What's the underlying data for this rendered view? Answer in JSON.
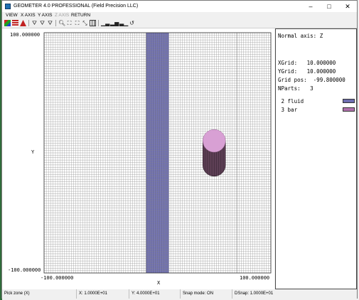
{
  "window": {
    "title": "GEOMETER 4.0 PROFESSIONAL (Field Precision LLC)",
    "minimize_glyph": "–",
    "maximize_glyph": "□",
    "close_glyph": "✕"
  },
  "menu": [
    {
      "label": "VIEW",
      "enabled": true
    },
    {
      "label": "X AXIS",
      "enabled": true
    },
    {
      "label": "Y AXIS",
      "enabled": true
    },
    {
      "label": "Z AXIS",
      "enabled": false
    },
    {
      "label": "RETURN",
      "enabled": true
    }
  ],
  "toolbar": [
    "palette-icon",
    "layers-icon",
    "fill-icon",
    "filter-icon",
    "filter-list-icon",
    "filter-down-icon",
    "zoom-icon",
    "zoom-window-icon",
    "zoom-fit-icon",
    "zoom-out-icon",
    "grid-icon",
    "bar-chart-icon",
    "histogram-icon",
    "chart-alt-icon",
    "undo-icon"
  ],
  "plot": {
    "x_min_label": "-100.000000",
    "x_max_label": "100.000000",
    "y_max_label": "100.000000",
    "y_min_label": "-100.000000",
    "x_axis_label": "X",
    "y_axis_label": "Y",
    "x_range": [
      -100,
      100
    ],
    "y_range": [
      -100,
      100
    ],
    "grid_spacing": 2,
    "coarse_lines_x": [
      -10,
      70
    ],
    "parts": [
      {
        "name": "fluid",
        "shape": "vertical-band",
        "x_from": -10,
        "x_to": 10,
        "color": "#7b7bb9"
      },
      {
        "name": "bar",
        "shape": "rod-end-on",
        "center_x": 50,
        "center_y": 10,
        "radius": 10,
        "lower_y": -10,
        "top_color": "#d8a0d4",
        "body_color": "#5d3f55"
      }
    ]
  },
  "info": {
    "normal_axis": "Normal axis: Z",
    "xgrid": "XGrid:   10.000000",
    "ygrid": "YGrid:   10.000000",
    "grid_pos": "Grid pos:  -99.800000",
    "nparts": "NParts:   3",
    "legend": [
      {
        "label": " 2 fluid",
        "color": "#6d6db0"
      },
      {
        "label": " 3 bar",
        "color": "#b070ac"
      }
    ]
  },
  "status": {
    "pick": "Pick zone (X)",
    "x": "X:   1.0000E+01",
    "y": "Y:   4.0000E+01",
    "snap": "Snap mode: ON",
    "dsnap": "DSnap:  1.0000E+01"
  }
}
